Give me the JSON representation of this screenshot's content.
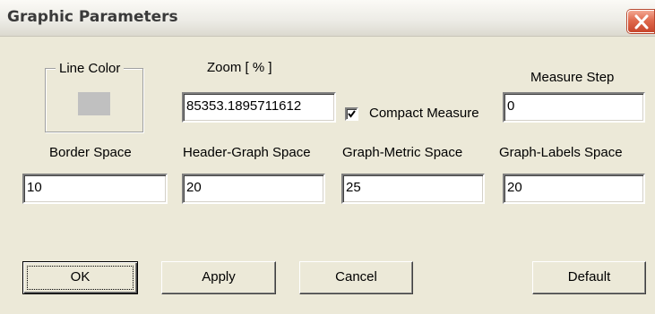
{
  "window": {
    "title": "Graphic Parameters"
  },
  "line_color": {
    "label": "Line Color",
    "swatch_color": "#c0c0c0"
  },
  "zoom": {
    "label": "Zoom [ % ]",
    "value": "85353.1895711612"
  },
  "compact_measure": {
    "label": "Compact Measure",
    "checked": true
  },
  "measure_step": {
    "label": "Measure Step",
    "value": "0"
  },
  "border_space": {
    "label": "Border Space",
    "value": "10"
  },
  "header_graph_space": {
    "label": "Header-Graph Space",
    "value": "20"
  },
  "graph_metric_space": {
    "label": "Graph-Metric Space",
    "value": "25"
  },
  "graph_labels_space": {
    "label": "Graph-Labels Space",
    "value": "20"
  },
  "buttons": {
    "ok": "OK",
    "apply": "Apply",
    "cancel": "Cancel",
    "default": "Default"
  },
  "icons": {
    "close": "close-icon",
    "checkmark": "checkmark-icon"
  }
}
